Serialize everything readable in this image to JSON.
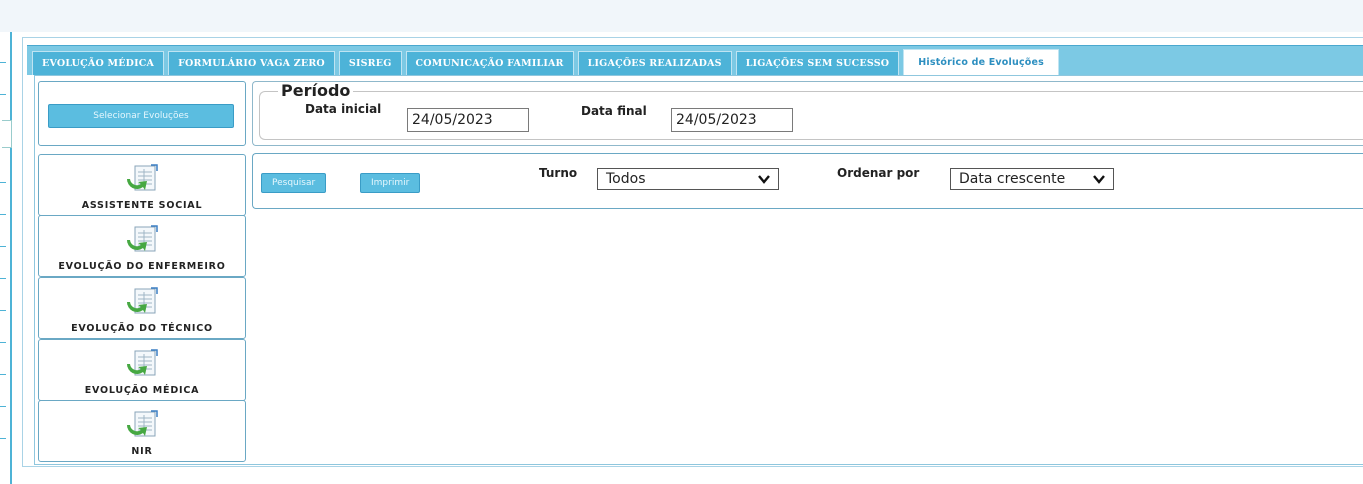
{
  "tabs": [
    {
      "label": "EVOLUÇÃO MÉDICA",
      "active": false
    },
    {
      "label": "FORMULÁRIO VAGA ZERO",
      "active": false
    },
    {
      "label": "SISREG",
      "active": false
    },
    {
      "label": "COMUNICAÇÃO FAMILIAR",
      "active": false
    },
    {
      "label": "LIGAÇÕES REALIZADAS",
      "active": false
    },
    {
      "label": "LIGAÇÕES SEM SUCESSO",
      "active": false
    },
    {
      "label": "Histórico de Evoluções",
      "active": true
    }
  ],
  "sidebar": {
    "select_button": "Selecionar Evoluções",
    "categories": [
      {
        "label": "ASSISTENTE SOCIAL",
        "icon": "spreadsheet-arrow-icon"
      },
      {
        "label": "EVOLUÇÃO DO ENFERMEIRO",
        "icon": "spreadsheet-arrow-icon"
      },
      {
        "label": "EVOLUÇÃO DO TÉCNICO",
        "icon": "spreadsheet-arrow-icon"
      },
      {
        "label": "EVOLUÇÃO MÉDICA",
        "icon": "spreadsheet-arrow-icon"
      },
      {
        "label": "NIR",
        "icon": "spreadsheet-arrow-icon"
      }
    ]
  },
  "period": {
    "legend": "Período",
    "start_label": "Data inicial",
    "start_value": "24/05/2023",
    "end_label": "Data final",
    "end_value": "24/05/2023"
  },
  "search": {
    "search_button": "Pesquisar",
    "print_button": "Imprimir",
    "shift_label": "Turno",
    "shift_value": "Todos",
    "order_label": "Ordenar por",
    "order_value": "Data crescente"
  },
  "colors": {
    "accent": "#4db3d8",
    "tabbar": "#7cc9e4",
    "active_tab_text": "#2d8fc0"
  }
}
